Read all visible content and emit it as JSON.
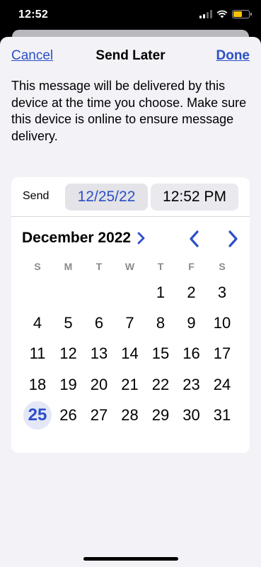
{
  "status": {
    "time": "12:52"
  },
  "colors": {
    "accent": "#2c4fc7",
    "sheet_background": "#f2f2f7",
    "battery": "#f5c400"
  },
  "nav": {
    "cancel": "Cancel",
    "title": "Send Later",
    "done": "Done"
  },
  "info_text": "This message will be delivered by this device at the time you choose. Make sure this device is online to ensure message delivery.",
  "send": {
    "label": "Send",
    "date": "12/25/22",
    "time": "12:52 PM"
  },
  "calendar": {
    "month_year": "December 2022",
    "weekdays": [
      "S",
      "M",
      "T",
      "W",
      "T",
      "F",
      "S"
    ],
    "first_weekday_index": 4,
    "days_in_month": 31,
    "selected_day": 25,
    "days": [
      "1",
      "2",
      "3",
      "4",
      "5",
      "6",
      "7",
      "8",
      "9",
      "10",
      "11",
      "12",
      "13",
      "14",
      "15",
      "16",
      "17",
      "18",
      "19",
      "20",
      "21",
      "22",
      "23",
      "24",
      "25",
      "26",
      "27",
      "28",
      "29",
      "30",
      "31"
    ]
  },
  "icons": {
    "month_expand": "chevron-right-icon",
    "prev": "chevron-left-icon",
    "next": "chevron-right-icon"
  }
}
